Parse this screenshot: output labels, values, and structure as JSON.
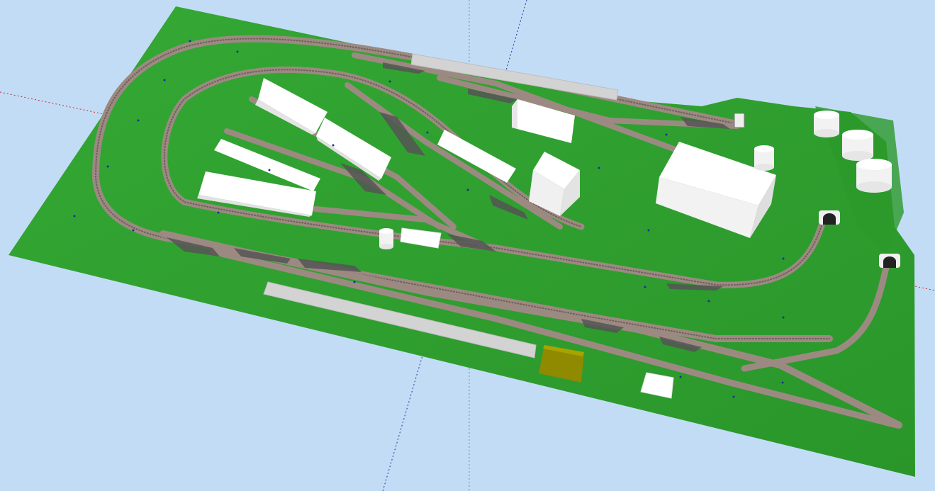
{
  "viewport": {
    "background": "#c3dcf6",
    "axis_colors": {
      "red": "#c03030",
      "green": "#37b86a",
      "blue": "#1a2f9c"
    }
  },
  "layout_board": {
    "board_color": "#2fa02f",
    "track_color": "#9c8a82",
    "platform_color": "#d3d3d3",
    "building_color": "#ffffff",
    "highlighted_block_color": "#8f8a00"
  }
}
